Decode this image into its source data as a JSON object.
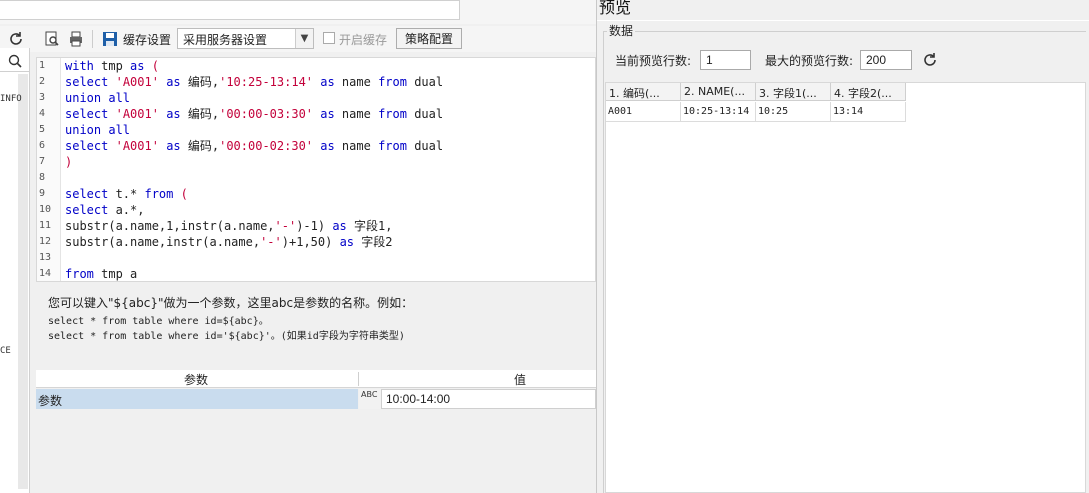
{
  "toolbar": {
    "cache_settings_label": "缓存设置",
    "cache_mode_value": "采用服务器设置",
    "enable_cache_label": "开启缓存",
    "strategy_button": "策略配置"
  },
  "sidebar": {
    "labels": [
      "INFO",
      "CE"
    ]
  },
  "editor": {
    "lines": [
      {
        "n": "1",
        "tokens": [
          {
            "t": "with",
            "c": "kw"
          },
          {
            "t": " tmp ",
            "c": "id"
          },
          {
            "t": "as",
            "c": "kw"
          },
          {
            "t": " (",
            "c": "str"
          }
        ]
      },
      {
        "n": "2",
        "tokens": [
          {
            "t": "select",
            "c": "kw"
          },
          {
            "t": " ",
            "c": "id"
          },
          {
            "t": "'A001'",
            "c": "str"
          },
          {
            "t": " ",
            "c": "id"
          },
          {
            "t": "as",
            "c": "kw"
          },
          {
            "t": " 编码,",
            "c": "id"
          },
          {
            "t": "'10:25-13:14'",
            "c": "str"
          },
          {
            "t": " ",
            "c": "id"
          },
          {
            "t": "as",
            "c": "kw"
          },
          {
            "t": " name ",
            "c": "id"
          },
          {
            "t": "from",
            "c": "kw"
          },
          {
            "t": " dual",
            "c": "id"
          }
        ]
      },
      {
        "n": "3",
        "tokens": [
          {
            "t": "union all",
            "c": "kw"
          }
        ]
      },
      {
        "n": "4",
        "tokens": [
          {
            "t": "select",
            "c": "kw"
          },
          {
            "t": " ",
            "c": "id"
          },
          {
            "t": "'A001'",
            "c": "str"
          },
          {
            "t": " ",
            "c": "id"
          },
          {
            "t": "as",
            "c": "kw"
          },
          {
            "t": " 编码,",
            "c": "id"
          },
          {
            "t": "'00:00-03:30'",
            "c": "str"
          },
          {
            "t": " ",
            "c": "id"
          },
          {
            "t": "as",
            "c": "kw"
          },
          {
            "t": " name ",
            "c": "id"
          },
          {
            "t": "from",
            "c": "kw"
          },
          {
            "t": " dual",
            "c": "id"
          }
        ]
      },
      {
        "n": "5",
        "tokens": [
          {
            "t": "union all",
            "c": "kw"
          }
        ]
      },
      {
        "n": "6",
        "tokens": [
          {
            "t": "select",
            "c": "kw"
          },
          {
            "t": " ",
            "c": "id"
          },
          {
            "t": "'A001'",
            "c": "str"
          },
          {
            "t": " ",
            "c": "id"
          },
          {
            "t": "as",
            "c": "kw"
          },
          {
            "t": " 编码,",
            "c": "id"
          },
          {
            "t": "'00:00-02:30'",
            "c": "str"
          },
          {
            "t": " ",
            "c": "id"
          },
          {
            "t": "as",
            "c": "kw"
          },
          {
            "t": " name ",
            "c": "id"
          },
          {
            "t": "from",
            "c": "kw"
          },
          {
            "t": " dual",
            "c": "id"
          }
        ]
      },
      {
        "n": "7",
        "tokens": [
          {
            "t": ")",
            "c": "str"
          }
        ]
      },
      {
        "n": "8",
        "tokens": []
      },
      {
        "n": "9",
        "tokens": [
          {
            "t": "select",
            "c": "kw"
          },
          {
            "t": " t.* ",
            "c": "id"
          },
          {
            "t": "from",
            "c": "kw"
          },
          {
            "t": " (",
            "c": "str"
          }
        ]
      },
      {
        "n": "10",
        "tokens": [
          {
            "t": "select",
            "c": "kw"
          },
          {
            "t": " a.*,",
            "c": "id"
          }
        ]
      },
      {
        "n": "11",
        "tokens": [
          {
            "t": "substr(a.name,1,instr(a.name,",
            "c": "id"
          },
          {
            "t": "'-'",
            "c": "str"
          },
          {
            "t": ")-1) ",
            "c": "id"
          },
          {
            "t": "as",
            "c": "kw"
          },
          {
            "t": " 字段1,",
            "c": "id"
          }
        ]
      },
      {
        "n": "12",
        "tokens": [
          {
            "t": "substr(a.name,instr(a.name,",
            "c": "id"
          },
          {
            "t": "'-'",
            "c": "str"
          },
          {
            "t": ")+1,50) ",
            "c": "id"
          },
          {
            "t": "as",
            "c": "kw"
          },
          {
            "t": " 字段2",
            "c": "id"
          }
        ]
      },
      {
        "n": "13",
        "tokens": []
      },
      {
        "n": "14",
        "tokens": [
          {
            "t": "from",
            "c": "kw"
          },
          {
            "t": " tmp a",
            "c": "id"
          }
        ]
      }
    ]
  },
  "hint": {
    "line1": "您可以键入\"${abc}\"做为一个参数，这里abc是参数的名称。例如：",
    "line2": "select * from table where id=${abc}。",
    "line3": "select * from table where id='${abc}'。(如果id字段为字符串类型)"
  },
  "params": {
    "col_name": "参数",
    "col_value": "值",
    "row_name": "参数",
    "row_type": "ABC",
    "row_value": "10:00-14:00"
  },
  "preview": {
    "title": "预览",
    "group_label": "数据",
    "current_rows_label": "当前预览行数:",
    "current_rows_value": "1",
    "max_rows_label": "最大的预览行数:",
    "max_rows_value": "200",
    "columns": [
      "1. 编码(...",
      "2. NAME(...",
      "3. 字段1(...",
      "4. 字段2(..."
    ],
    "rows": [
      [
        "A001",
        "10:25-13:14",
        "10:25",
        "13:14"
      ]
    ]
  },
  "icons": {
    "refresh": "refresh-icon",
    "search": "search-icon",
    "find": "find-in-file-icon",
    "print": "print-icon",
    "save": "save-icon"
  }
}
